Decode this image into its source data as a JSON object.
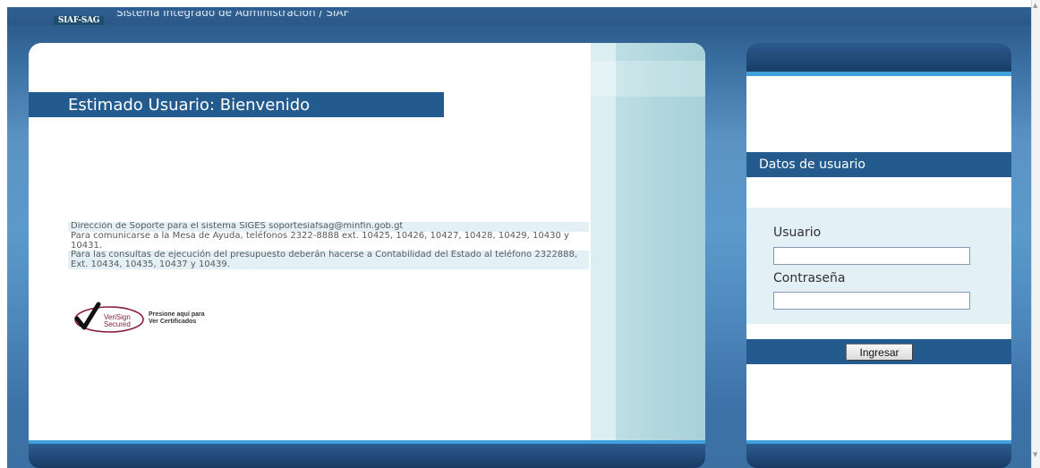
{
  "header": {
    "logo_text": "SIAF-SAG",
    "title": "Sistema Integrado de Administración / SIAF"
  },
  "welcome": {
    "heading": "Estimado Usuario: Bienvenido"
  },
  "info": {
    "support_line": "Dirección de Soporte para el sistema SIGES soportesiafsag@minfin.gob.gt",
    "helpdesk": "Para comunicarse a la Mesa de Ayuda, teléfonos 2322-8888 ext. 10425, 10426, 10427, 10428, 10429, 10430 y 10431.",
    "budget": "Para las consultas de ejecución del presupuesto deberán hacerse a Contabilidad del Estado al teléfono 2322888, Ext. 10434, 10435, 10437 y 10439."
  },
  "verisign": {
    "seal_line1": "VeriSign",
    "seal_line2": "Secured",
    "link_line1": "Presione aquí para",
    "link_line2": "Ver Certificados"
  },
  "login": {
    "header": "Datos de usuario",
    "user_label": "Usuario",
    "user_value": "",
    "password_label": "Contraseña",
    "password_value": "",
    "submit_label": "Ingresar"
  },
  "colors": {
    "brand_dark": "#245b8f",
    "accent": "#3fa0dc",
    "light_panel": "#e3f1f7"
  }
}
